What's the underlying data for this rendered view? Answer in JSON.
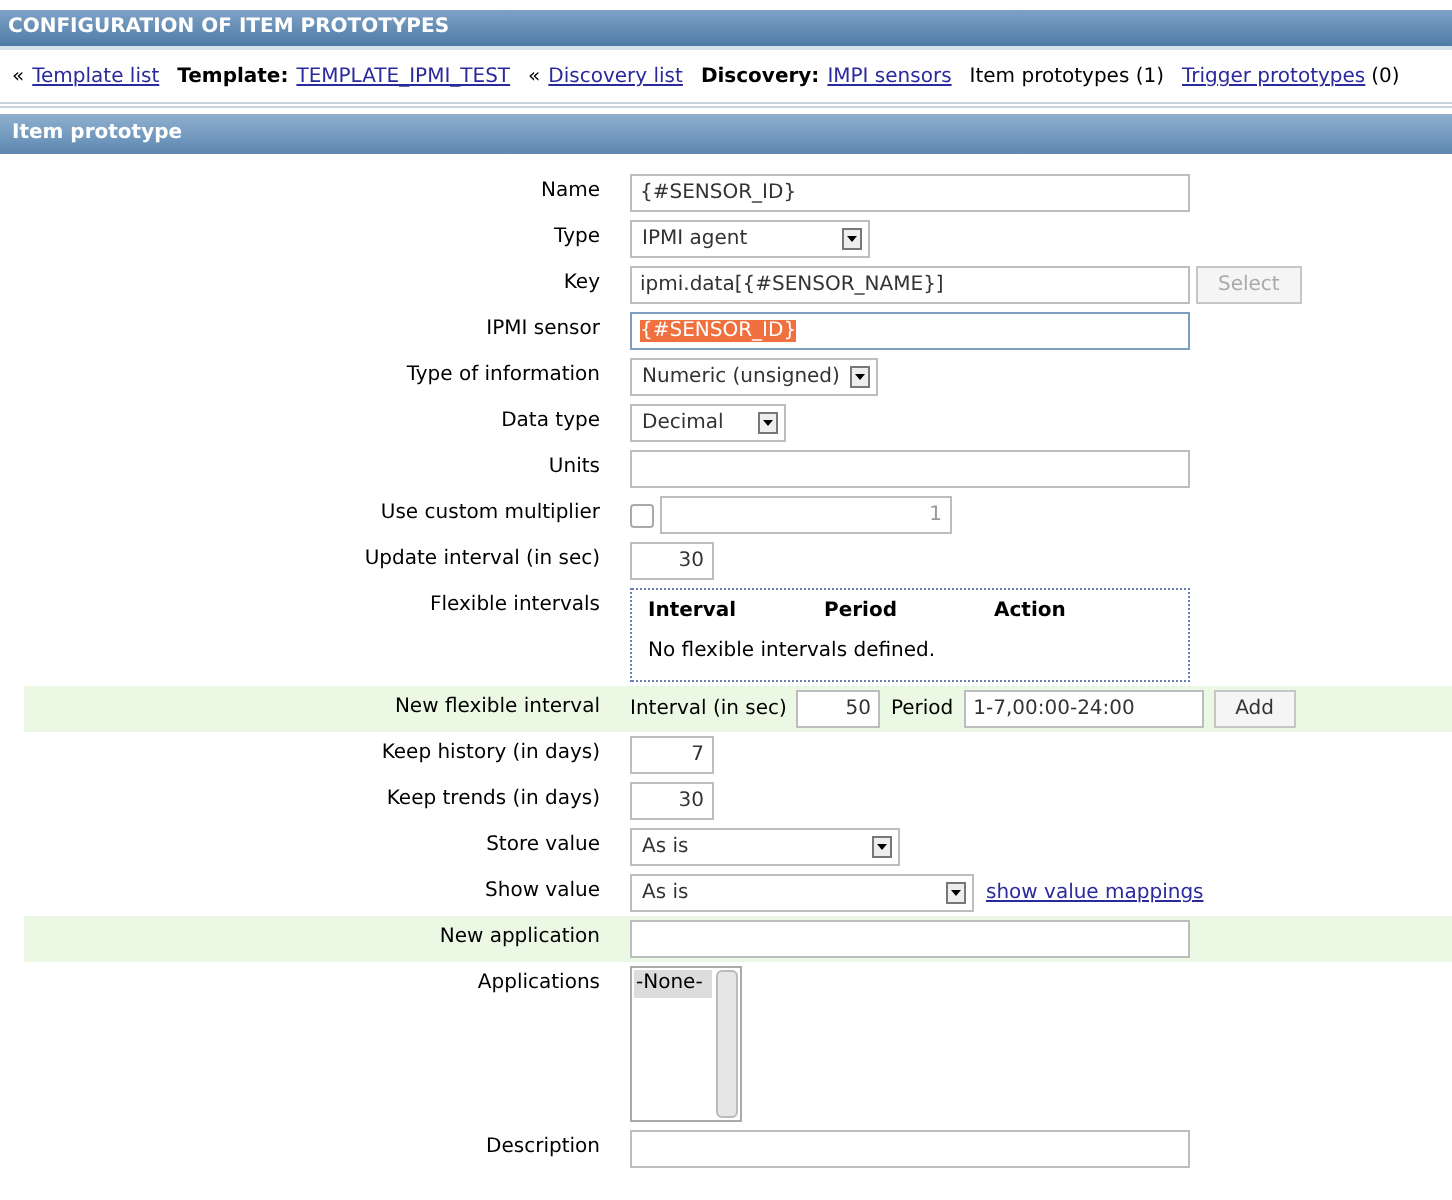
{
  "header": {
    "title": "CONFIGURATION OF ITEM PROTOTYPES"
  },
  "breadcrumbs": [
    {
      "kind": "link",
      "prefix": "«",
      "text": "Template list"
    },
    {
      "kind": "labeled",
      "label": "Template:",
      "text": "TEMPLATE_IPMI_TEST"
    },
    {
      "kind": "link",
      "prefix": "«",
      "text": "Discovery list"
    },
    {
      "kind": "labeled",
      "label": "Discovery:",
      "text": "IMPI sensors"
    },
    {
      "kind": "plain",
      "text": "Item prototypes (1)"
    },
    {
      "kind": "counted",
      "text": "Trigger prototypes",
      "count": "(0)"
    }
  ],
  "section": {
    "title": "Item prototype"
  },
  "rows": [
    {
      "kind": "text",
      "label": "Name",
      "value": "{#SENSOR_ID}",
      "highlighted": false
    },
    {
      "kind": "select",
      "label": "Type",
      "value": "IPMI agent",
      "highlighted": false
    },
    {
      "kind": "text_button",
      "label": "Key",
      "value": "ipmi.data[{#SENSOR_NAME}]",
      "button": "Select",
      "disabled": true,
      "highlighted": false
    },
    {
      "kind": "text",
      "label": "IPMI sensor",
      "value": "{#SENSOR_ID}",
      "selected_text": true,
      "focused": true,
      "highlighted": false
    },
    {
      "kind": "select",
      "label": "Type of information",
      "value": "Numeric (unsigned)",
      "highlighted": false
    },
    {
      "kind": "select",
      "label": "Data type",
      "value": "Decimal",
      "highlighted": false
    },
    {
      "kind": "text",
      "label": "Units",
      "value": "",
      "highlighted": false
    },
    {
      "kind": "checkbox_text",
      "label": "Use custom multiplier",
      "checked": false,
      "value": "1",
      "value_disabled": true,
      "highlighted": false
    },
    {
      "kind": "number",
      "label": "Update interval (in sec)",
      "value": "30",
      "highlighted": false
    },
    {
      "kind": "flex_table",
      "label": "Flexible intervals",
      "columns": [
        "Interval",
        "Period",
        "Action"
      ],
      "empty": "No flexible intervals defined.",
      "highlighted": false
    },
    {
      "kind": "flex_new",
      "label": "New flexible interval",
      "interval_label": "Interval (in sec)",
      "interval": "50",
      "period_label": "Period",
      "period": "1-7,00:00-24:00",
      "button": "Add",
      "highlighted": true
    },
    {
      "kind": "number",
      "label": "Keep history (in days)",
      "value": "7",
      "highlighted": false
    },
    {
      "kind": "number",
      "label": "Keep trends (in days)",
      "value": "30",
      "highlighted": false
    },
    {
      "kind": "select",
      "label": "Store value",
      "value": "As is",
      "highlighted": false
    },
    {
      "kind": "select_link",
      "label": "Show value",
      "value": "As is",
      "link": "show value mappings",
      "highlighted": false
    },
    {
      "kind": "text",
      "label": "New application",
      "value": "",
      "highlighted": true
    },
    {
      "kind": "listbox",
      "label": "Applications",
      "options": [
        {
          "text": "-None-",
          "selected": true
        }
      ],
      "highlighted": false
    },
    {
      "kind": "text",
      "label": "Description",
      "value": "",
      "highlighted": false
    }
  ]
}
